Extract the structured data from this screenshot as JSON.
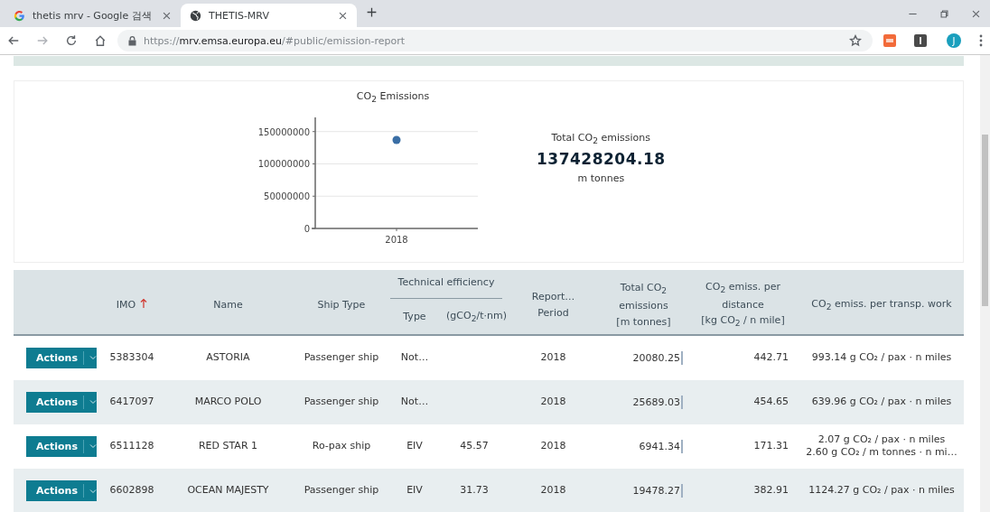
{
  "browser": {
    "tabs": [
      {
        "title": "thetis mrv - Google 검색",
        "selected": false,
        "kind": "google"
      },
      {
        "title": "THETIS-MRV",
        "selected": true,
        "kind": "globe"
      }
    ],
    "url": {
      "scheme": "https://",
      "host": "mrv.emsa.europa.eu",
      "path": "/#public/emission-report"
    },
    "profile_initial": "J"
  },
  "summary": {
    "chart_title": "CO$_{2}$ Emissions",
    "chart_data": {
      "type": "scatter",
      "categories": [
        "2018"
      ],
      "ylim": [
        0,
        172000000
      ],
      "yticks": [
        0,
        50000000,
        100000000,
        150000000
      ],
      "grid": true,
      "series": [
        {
          "color": "#3a6ea5",
          "values": [
            137000000
          ]
        }
      ]
    },
    "total_label": "Total CO$_{2}$ emissions",
    "total_value": "137428204.18",
    "total_unit": "m tonnes"
  },
  "table": {
    "columns": [
      {
        "kind": "plain",
        "lines": [
          "IMO"
        ],
        "sorted": true
      },
      {
        "kind": "plain",
        "lines": [
          "Name"
        ],
        "sorted": false
      },
      {
        "kind": "plain",
        "lines": [
          "Ship Type"
        ],
        "sorted": false
      },
      {
        "kind": "group",
        "lines": [
          "Technical efficiency"
        ],
        "sorted": false,
        "children": [
          {
            "lines": [
              "Type"
            ]
          },
          {
            "lines": [
              "(gCO$_{2}$/t·nm)"
            ]
          }
        ]
      },
      {
        "kind": "plain",
        "lines": [
          "Report…",
          "Period"
        ],
        "sorted": false
      },
      {
        "kind": "plain",
        "lines": [
          "Total CO$_{2}$",
          "emissions",
          "[m tonnes]"
        ],
        "sorted": false
      },
      {
        "kind": "plain",
        "lines": [
          "CO$_{2}$ emiss. per",
          "distance",
          "[kg CO$_{2}$ / n mile]"
        ],
        "sorted": false
      },
      {
        "kind": "plain",
        "lines": [
          "CO$_{2}$ emiss. per transp. work"
        ],
        "sorted": false
      }
    ],
    "rows": [
      {
        "action": "Actions",
        "imo": "5383304",
        "name": "ASTORIA",
        "ship_type": "Passenger ship",
        "eff_type": "Not…",
        "period": "2018",
        "total": "20080.25",
        "per_distance": "442.71",
        "per_work": [
          "993.14 g CO₂ / pax · n miles"
        ]
      },
      {
        "action": "Actions",
        "imo": "6417097",
        "name": "MARCO POLO",
        "ship_type": "Passenger ship",
        "eff_type": "Not…",
        "period": "2018",
        "total": "25689.03",
        "per_distance": "454.65",
        "per_work": [
          "639.96 g CO₂ / pax · n miles"
        ]
      },
      {
        "action": "Actions",
        "imo": "6511128",
        "name": "RED STAR 1",
        "ship_type": "Ro-pax ship",
        "eff_type": "EIV",
        "eff_value": "45.57",
        "period": "2018",
        "total": "6941.34",
        "per_distance": "171.31",
        "per_work": [
          "2.07 g CO₂ / pax · n miles",
          "2.60 g CO₂ / m tonnes · n mi…"
        ]
      },
      {
        "action": "Actions",
        "imo": "6602898",
        "name": "OCEAN MAJESTY",
        "ship_type": "Passenger ship",
        "eff_type": "EIV",
        "eff_value": "31.73",
        "period": "2018",
        "total": "19478.27",
        "per_distance": "382.91",
        "per_work": [
          "1124.27 g CO₂ / pax · n miles"
        ]
      }
    ]
  }
}
